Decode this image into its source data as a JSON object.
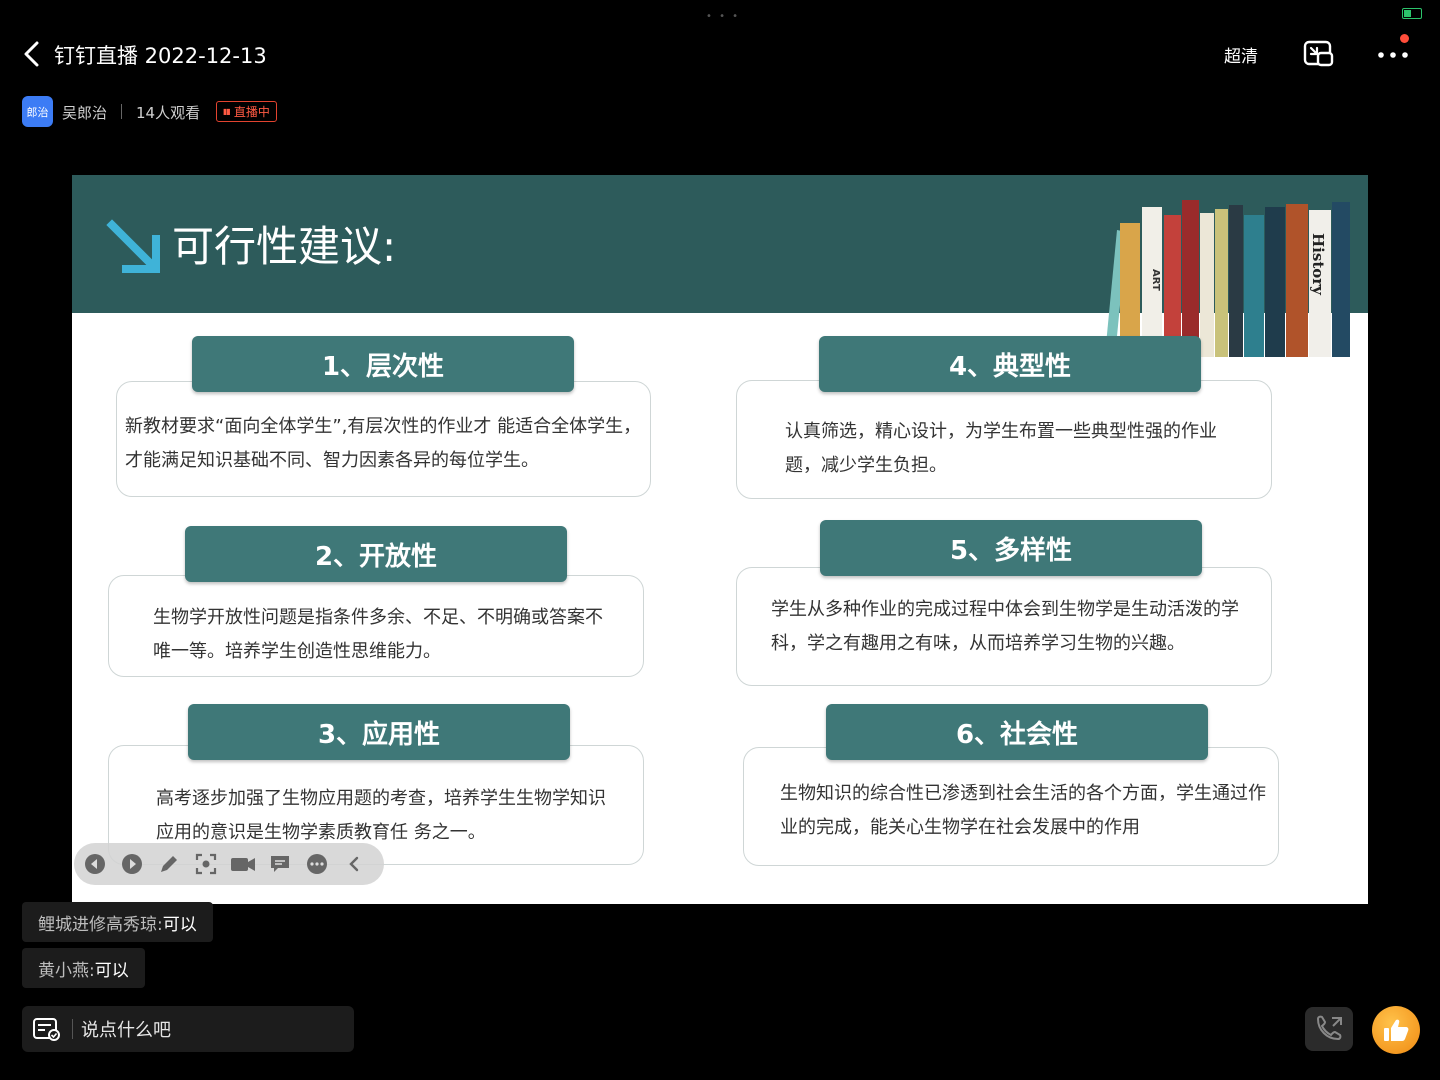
{
  "header": {
    "title": "钉钉直播 2022-12-13",
    "quality_label": "超清",
    "host_avatar_text": "郎治",
    "host_name": "吴郎治",
    "viewers": "14人观看",
    "live_label": "直播中",
    "icons": [
      "back-arrow-icon",
      "pip-icon",
      "more-icon"
    ]
  },
  "slide": {
    "title": "可行性建议:",
    "book_labels": [
      "ART",
      "History"
    ],
    "cards": [
      {
        "heading": "1、层次性",
        "text": "新教材要求“面向全体学生”,有层次性的作业才 能适合全体学生，才能满足知识基础不同、智力因素各异的每位学生。"
      },
      {
        "heading": "2、开放性",
        "text": "生物学开放性问题是指条件多余、不足、不明确或答案不唯一等。培养学生创造性思维能力。"
      },
      {
        "heading": "3、应用性",
        "text": "高考逐步加强了生物应用题的考查，培养学生生物学知识应用的意识是生物学素质教育任 务之一。"
      },
      {
        "heading": "4、典型性",
        "text": "认真筛选，精心设计，为学生布置一些典型性强的作业题，减少学生负担。"
      },
      {
        "heading": "5、多样性",
        "text": "学生从多种作业的完成过程中体会到生物学是生动活泼的学科，学之有趣用之有味，从而培养学习生物的兴趣。"
      },
      {
        "heading": "6、社会性",
        "text": "生物知识的综合性已渗透到社会生活的各个方面，学生通过作业的完成，能关心生物学在社会发展中的作用"
      }
    ]
  },
  "toolbar_icons": [
    "prev-icon",
    "next-icon",
    "pen-icon",
    "screenshot-icon",
    "camera-icon",
    "comment-icon",
    "more-icon",
    "collapse-icon"
  ],
  "comments": [
    {
      "who": "鲤城进修高秀琼: ",
      "msg": "可以"
    },
    {
      "who": "黄小燕: ",
      "msg": "可以"
    }
  ],
  "input": {
    "placeholder": "说点什么吧"
  },
  "colors": {
    "slide_header": "#2d5b5b",
    "card_head": "#3f7878",
    "live": "#ff5a43",
    "like": "#f5a623"
  }
}
